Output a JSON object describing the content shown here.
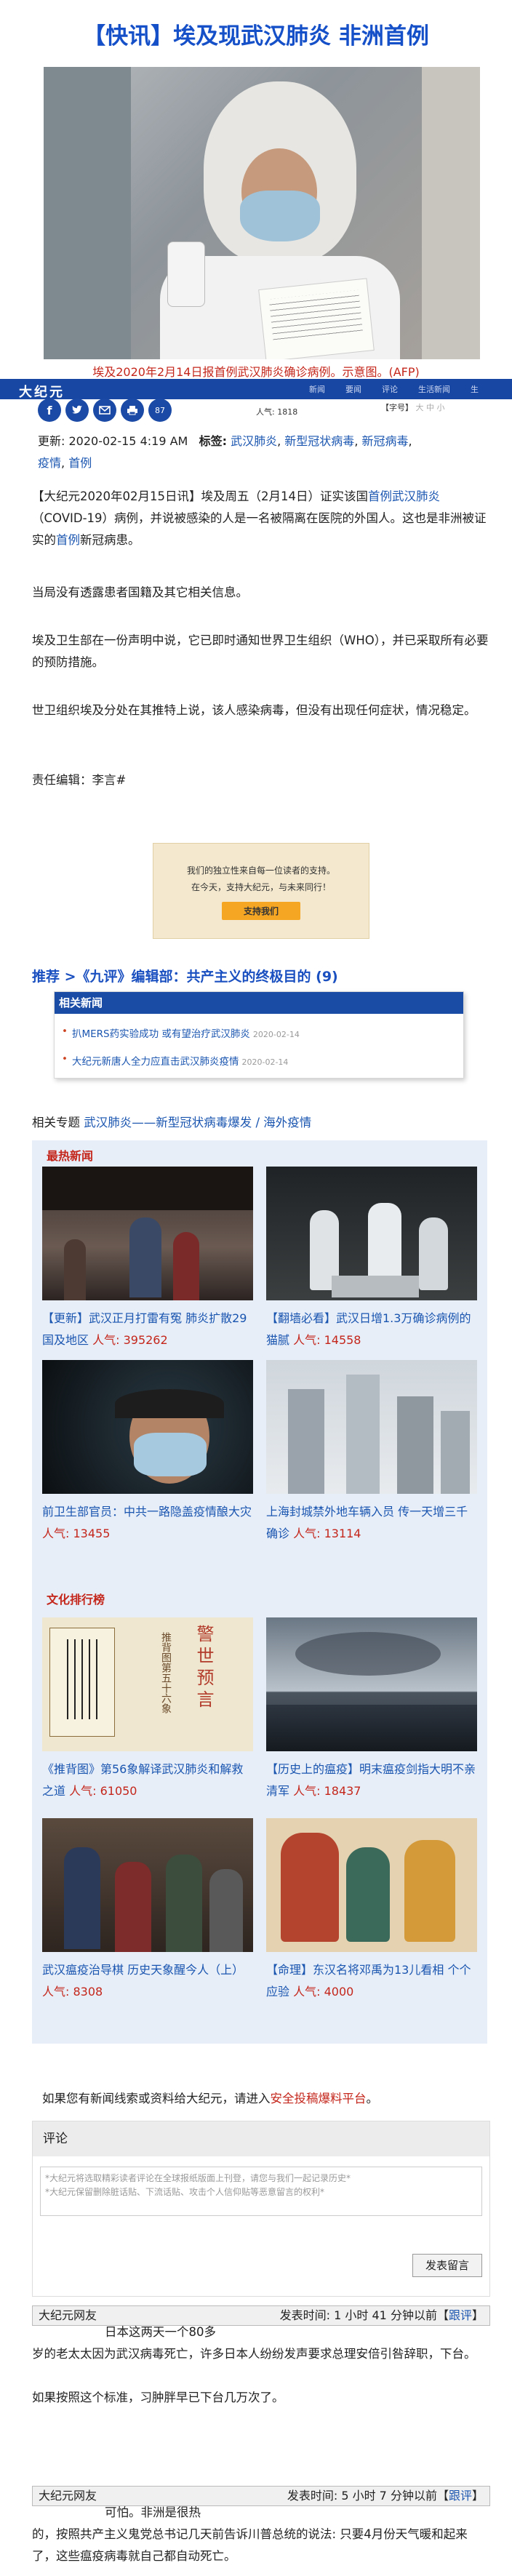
{
  "title": "【快讯】埃及现武汉肺炎 非洲首例",
  "hero_caption": "埃及2020年2月14日报首例武汉肺炎确诊病例。示意图。(AFP)",
  "site_logo": "大纪元",
  "nav_items": [
    "新闻",
    "要闻",
    "评论",
    "生活新闻",
    "生"
  ],
  "share": {
    "more_label": "87"
  },
  "views": "人气: 1818",
  "font_size": {
    "label": "【字号】",
    "large": "大",
    "medium": "中",
    "small": "小"
  },
  "meta": {
    "updated_label": "更新:",
    "updated": "2020-02-15 4:19 AM",
    "tags_label": "标签:",
    "tags": [
      "武汉肺炎",
      "新型冠状病毒",
      "新冠病毒",
      "疫情",
      "首例"
    ]
  },
  "body": {
    "p1_pre": "【大纪元2020年02月15日讯】埃及周五（2月14日）证实该国",
    "p1_link": "首例武汉肺炎",
    "p1_mid": "（COVID-19）病例，并说被感染的人是一名被隔离在医院的外国人。这也是非洲被证实的",
    "p1_link2": "首例",
    "p1_post": "新冠病患。",
    "p2": "当局没有透露患者国籍及其它相关信息。",
    "p3": "埃及卫生部在一份声明中说，它已即时通知世界卫生组织（WHO），并已采取所有必要的预防措施。",
    "p4": "世卫组织埃及分处在其推特上说，该人感染病毒，但没有出现任何症状，情况稳定。",
    "editor": "责任编辑：李言#"
  },
  "ad": {
    "line1": "我们的独立性来自每一位读者的支持。",
    "line2": "在今天，支持大纪元，与未来同行！",
    "button": "支持我们"
  },
  "recommend": "推荐 >《九评》编辑部：共产主义的终极目的 (9)",
  "related": {
    "header": "相关新闻",
    "items": [
      {
        "text": "扒MERS药实验成功 或有望治疗武汉肺炎",
        "date": "2020-02-14"
      },
      {
        "text": "大纪元新唐人全力应直击武汉肺炎疫情",
        "date": "2020-02-14"
      }
    ]
  },
  "topic": {
    "label": "相关专题",
    "link": "武汉肺炎——新型冠状病毒爆发 / 海外疫情"
  },
  "hot": {
    "header": "最热新闻",
    "items": [
      {
        "title": "【更新】武汉正月打雷有冤 肺炎扩散29国及地区",
        "pop": "人气: 395262"
      },
      {
        "title": "【翻墙必看】武汉日增1.3万确诊病例的猫腻",
        "pop": "人气: 14558"
      },
      {
        "title": "前卫生部官员：中共一路隐盖疫情酿大灾",
        "pop": "人气: 13455"
      },
      {
        "title": "上海封城禁外地车辆入员 传一天增三千确诊",
        "pop": "人气: 13114"
      }
    ]
  },
  "culture": {
    "header": "文化排行榜",
    "items": [
      {
        "title": "《推背图》第56象解译武汉肺炎和解救之道",
        "pop": "人气: 61050",
        "img_text1": "警世预言",
        "img_text2": "推背图第五十六象"
      },
      {
        "title": "【历史上的瘟疫】明末瘟疫剑指大明不亲清军",
        "pop": "人气: 18437"
      },
      {
        "title": "武汉瘟疫治导棋 历史天象醒今人（上）",
        "pop": "人气: 8308"
      },
      {
        "title": "【命理】东汉名将邓禹为13儿看相 个个应验",
        "pop": "人气: 4000"
      }
    ]
  },
  "tip": {
    "pre": "如果您有新闻线索或资料给大纪元，请进入",
    "link": "安全投稿爆料平台",
    "post": "。"
  },
  "comment": {
    "header": "评论",
    "placeholder_l1": "*大纪元将选取精彩读者评论在全球报纸版面上刊登，请您与我们一起记录历史*",
    "placeholder_l2": "*大纪元保留删除脏话贴、下流话贴、攻击个人信仰贴等恶意留言的权利*",
    "submit": "发表留言"
  },
  "comments": [
    {
      "author": "大纪元网友",
      "time": "发表时间: 1 小时 41 分钟以前",
      "reply": "跟评",
      "lines": [
        "日本这两天一个80多",
        "岁的老太太因为武汉病毒死亡，许多日本人纷纷发声要求总理安倍引咎辞职，下台。",
        "",
        "如果按照这个标准，习肿胖早已下台几万次了。"
      ]
    },
    {
      "author": "大纪元网友",
      "time": "发表时间: 5 小时 7 分钟以前",
      "reply": "跟评",
      "lines": [
        "可怕。非洲是很热",
        "的，按照共产主义鬼党总书记几天前告诉川普总统的说法: 只要4月份天气暖和起来了，这些瘟疫病毒就自己都自动死亡。"
      ]
    }
  ]
}
